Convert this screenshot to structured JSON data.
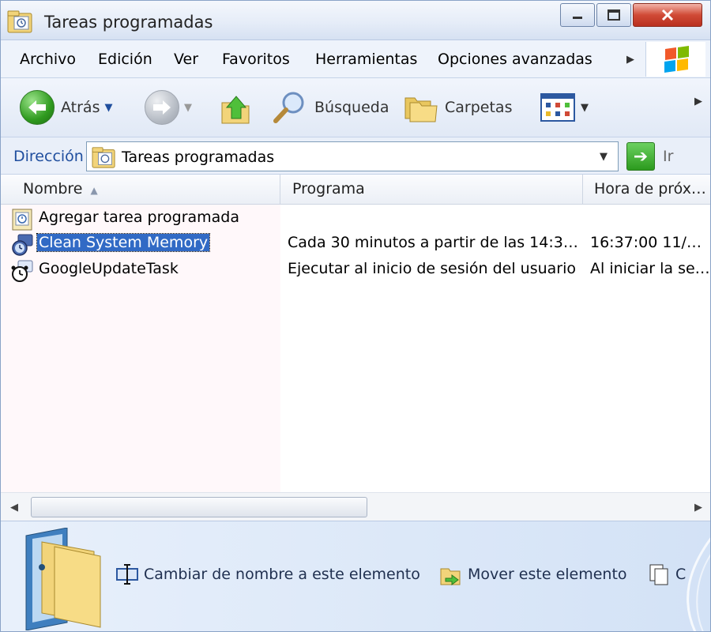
{
  "window": {
    "title": "Tareas programadas"
  },
  "menu": [
    "Archivo",
    "Edición",
    "Ver",
    "Favoritos",
    "Herramientas",
    "Opciones avanzadas"
  ],
  "toolbar": {
    "back_label": "Atrás",
    "search_label": "Búsqueda",
    "folders_label": "Carpetas"
  },
  "address": {
    "label": "Dirección",
    "value": "Tareas programadas",
    "go_label": "Ir"
  },
  "columns": [
    "Nombre",
    "Programa",
    "Hora de próx…"
  ],
  "rows": [
    {
      "name": "Agregar tarea programada",
      "program": "",
      "next_time": "",
      "icon": "add-task-icon",
      "selected": false
    },
    {
      "name": "Clean System Memory",
      "program": "Cada 30 minutos a partir de las 14:3…",
      "next_time": "16:37:00  11/…",
      "icon": "scheduled-task-icon",
      "selected": true
    },
    {
      "name": "GoogleUpdateTask",
      "program": "Ejecutar al inicio de sesión del usuario",
      "next_time": "Al iniciar la se…",
      "icon": "scheduled-task-icon",
      "selected": false
    }
  ],
  "tasks": [
    {
      "label": "Cambiar de nombre a este elemento",
      "icon": "rename-icon"
    },
    {
      "label": "Mover este elemento",
      "icon": "move-icon"
    },
    {
      "label": "C",
      "icon": "copy-icon"
    }
  ],
  "colors": {
    "selection": "#316ac5",
    "accent_blue": "#1f4e9e",
    "close_red": "#d04a36"
  }
}
